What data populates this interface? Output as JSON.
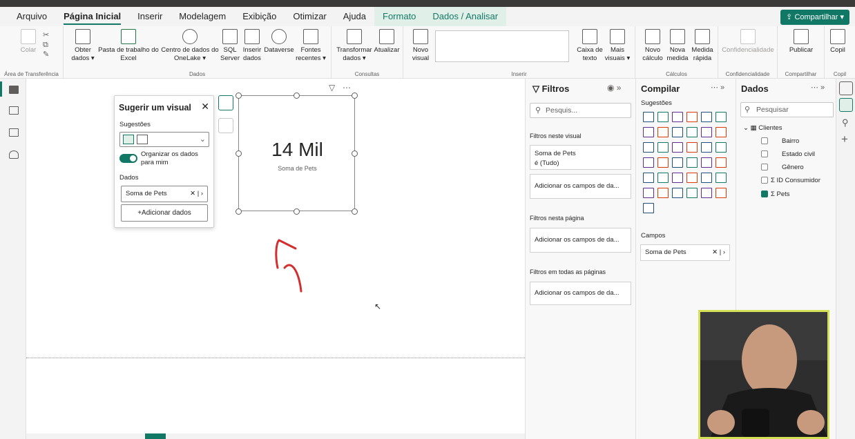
{
  "tabs": {
    "arquivo": "Arquivo",
    "inicial": "Página Inicial",
    "inserir": "Inserir",
    "modelagem": "Modelagem",
    "exibicao": "Exibição",
    "otimizar": "Otimizar",
    "ajuda": "Ajuda",
    "formato": "Formato",
    "dados": "Dados / Analisar"
  },
  "share": "Compartilhar",
  "ribbon": {
    "colar": "Colar",
    "area": "Área de Transferência",
    "obter1": "Obter",
    "obter2": "dados",
    "pasta1": "Pasta de trabalho do",
    "pasta2": "Excel",
    "centro1": "Centro de dados do",
    "centro2": "OneLake",
    "sql1": "SQL",
    "sql2": "Server",
    "inserir1": "Inserir",
    "inserir2": "dados",
    "dataverse": "Dataverse",
    "fontes1": "Fontes",
    "fontes2": "recentes",
    "dadosgrp": "Dados",
    "transformar1": "Transformar",
    "transformar2": "dados",
    "atualizar": "Atualizar",
    "consultas": "Consultas",
    "novo1": "Novo",
    "novo2": "visual",
    "caixa1": "Caixa de",
    "caixa2": "texto",
    "mais1": "Mais",
    "mais2": "visuais",
    "inserirgrp": "Inserir",
    "nmed1": "Novo",
    "nmed2": "cálculo",
    "nmeda1": "Nova",
    "nmeda2": "medida",
    "mrap1": "Medida",
    "mrap2": "rápida",
    "calculos": "Cálculos",
    "conf": "Confidencialidade",
    "confgrp": "Confidencialidade",
    "publicar": "Publicar",
    "compgrp": "Compartilhar",
    "copil": "Copil",
    "copilgrp": "Copil"
  },
  "suggest": {
    "title": "Sugerir um visual",
    "sugestoes": "Sugestões",
    "organize1": "Organizar os dados",
    "organize2": "para mim",
    "dados": "Dados",
    "field": "Soma de Pets",
    "add": "+Adicionar dados"
  },
  "card": {
    "value": "14 Mil",
    "label": "Soma de Pets"
  },
  "filters": {
    "title": "Filtros",
    "search": "Pesquis...",
    "sec1": "Filtros neste visual",
    "f1a": "Soma de Pets",
    "f1b": "é (Tudo)",
    "add": "Adicionar os campos de da...",
    "sec2": "Filtros nesta página",
    "sec3": "Filtros em todas as páginas"
  },
  "compile": {
    "title": "Compilar",
    "sugestoes": "Sugestões",
    "campos": "Campos",
    "field": "Soma de Pets"
  },
  "dados": {
    "title": "Dados",
    "search": "Pesquisar",
    "table": "Clientes",
    "fields": [
      "Bairro",
      "Estado civil",
      "Gênero",
      "ID Consumidor",
      "Pets"
    ]
  }
}
